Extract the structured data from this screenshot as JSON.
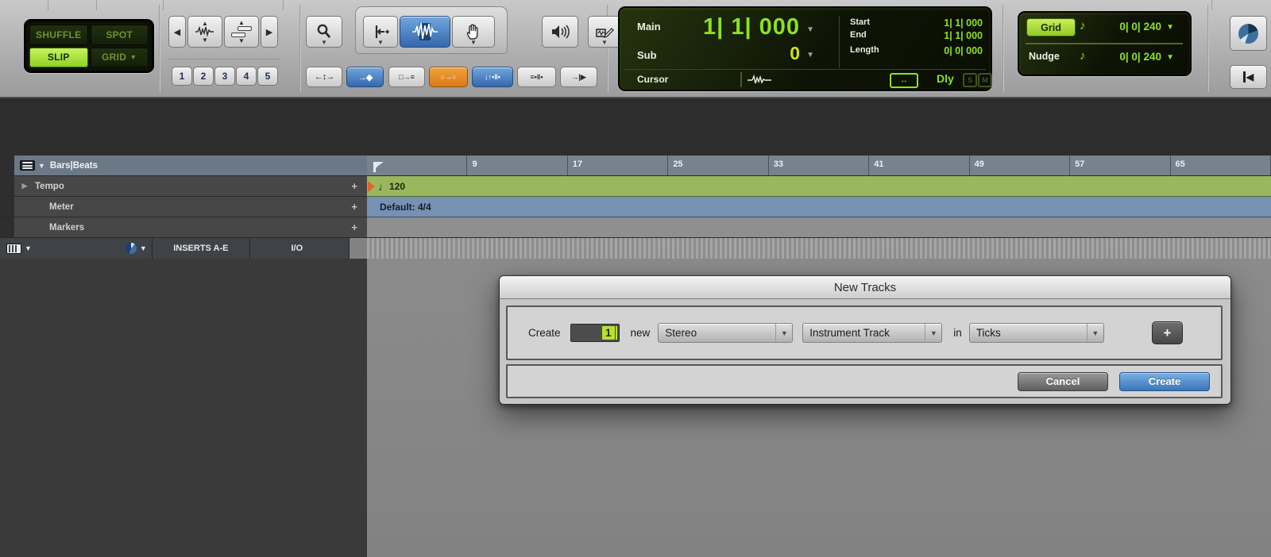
{
  "edit_modes": {
    "shuffle": "SHUFFLE",
    "spot": "SPOT",
    "slip": "SLIP",
    "grid": "GRID"
  },
  "zoom": {
    "presets": [
      "1",
      "2",
      "3",
      "4",
      "5"
    ]
  },
  "counter": {
    "main_label": "Main",
    "main_value": "1| 1| 000",
    "sub_label": "Sub",
    "sub_value": "0",
    "start_label": "Start",
    "start_value": "1| 1| 000",
    "end_label": "End",
    "end_value": "1| 1| 000",
    "length_label": "Length",
    "length_value": "0| 0| 000",
    "cursor_label": "Cursor",
    "dly_label": "Dly",
    "solo_label": "S",
    "mute_label": "M"
  },
  "grid_nudge": {
    "grid_label": "Grid",
    "grid_value": "0| 0| 240",
    "nudge_label": "Nudge",
    "nudge_value": "0| 0| 240",
    "note_icon": "♪"
  },
  "ruler": {
    "bars_beats_label": "Bars|Beats",
    "tempo_label": "Tempo",
    "meter_label": "Meter",
    "markers_label": "Markers",
    "add_label": "+",
    "bar_numbers": [
      "9",
      "17",
      "25",
      "33",
      "41",
      "49",
      "57",
      "65"
    ],
    "tempo_event": {
      "note": "♩",
      "value": "120"
    },
    "meter_event": "Default: 4/4"
  },
  "track_list_header": {
    "inserts": "INSERTS A-E",
    "io": "I/O"
  },
  "dialog": {
    "title": "New Tracks",
    "create_label": "Create",
    "track_count": "1",
    "new_label": "new",
    "track_width": "Stereo",
    "track_type": "Instrument Track",
    "in_label": "in",
    "track_timebase": "Ticks",
    "add_row_label": "+",
    "cancel_label": "Cancel",
    "create_button": "Create"
  },
  "colors": {
    "accent_green": "#9bdc2e",
    "led_text": "#8ce21e",
    "selection_blue": "#4a86c8",
    "highlight_orange": "#e08428",
    "create_blue": "#4d88c8"
  }
}
